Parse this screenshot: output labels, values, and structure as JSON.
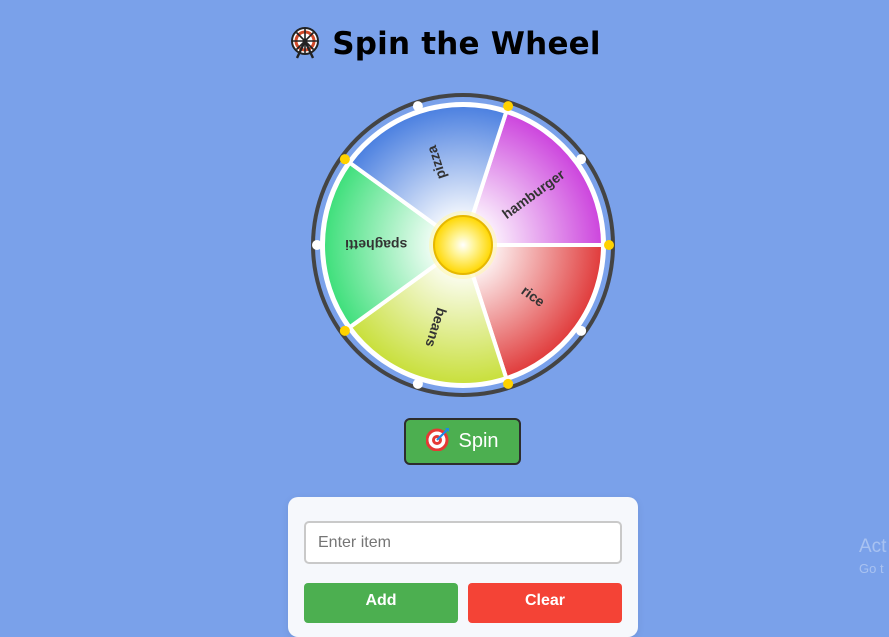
{
  "page": {
    "title": "Spin the Wheel",
    "title_icon": "ferris-wheel-icon"
  },
  "wheel": {
    "segments": [
      {
        "label": "hamburger",
        "color": "#cc44dd"
      },
      {
        "label": "rice",
        "color": "#e03a3a"
      },
      {
        "label": "beans",
        "color": "#c8df3a"
      },
      {
        "label": "spaghetti",
        "color": "#3ddf7a"
      },
      {
        "label": "pizza",
        "color": "#4a7fe0"
      }
    ],
    "rim_color": "#444444",
    "hub_color": "#ffd700",
    "peg_colors": [
      "#ffd200",
      "#ffffff"
    ]
  },
  "spin_button": {
    "label": "Spin",
    "icon": "target-dart-icon"
  },
  "panel": {
    "input_placeholder": "Enter item",
    "input_value": "",
    "add_label": "Add",
    "clear_label": "Clear"
  },
  "watermark": {
    "line1": "Act",
    "line2": "Go t"
  },
  "colors": {
    "background": "#7aa1ea",
    "add": "#4caf50",
    "clear": "#f44336"
  }
}
